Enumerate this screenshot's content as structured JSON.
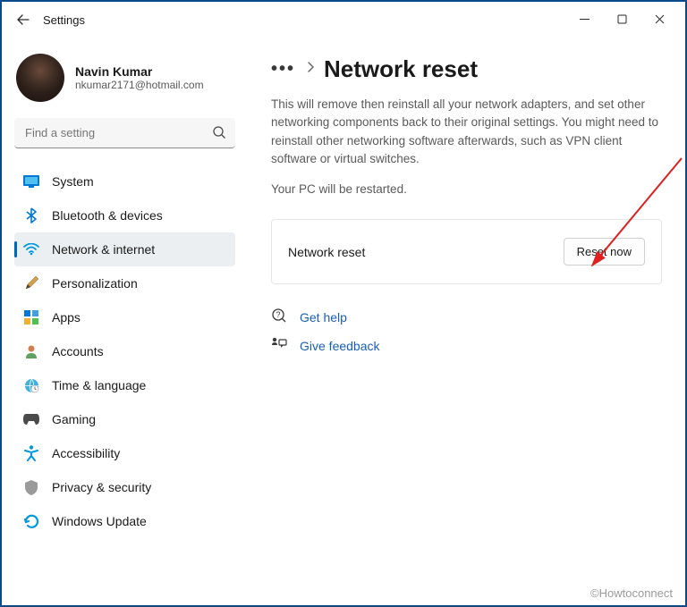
{
  "window": {
    "title": "Settings"
  },
  "user": {
    "name": "Navin Kumar",
    "email": "nkumar2171@hotmail.com"
  },
  "search": {
    "placeholder": "Find a setting"
  },
  "sidebar": {
    "items": [
      {
        "label": "System"
      },
      {
        "label": "Bluetooth & devices"
      },
      {
        "label": "Network & internet"
      },
      {
        "label": "Personalization"
      },
      {
        "label": "Apps"
      },
      {
        "label": "Accounts"
      },
      {
        "label": "Time & language"
      },
      {
        "label": "Gaming"
      },
      {
        "label": "Accessibility"
      },
      {
        "label": "Privacy & security"
      },
      {
        "label": "Windows Update"
      }
    ]
  },
  "page": {
    "title": "Network reset",
    "description": "This will remove then reinstall all your network adapters, and set other networking components back to their original settings. You might need to reinstall other networking software afterwards, such as VPN client software or virtual switches.",
    "restart_note": "Your PC will be restarted.",
    "card": {
      "title": "Network reset",
      "button": "Reset now"
    },
    "links": {
      "help": "Get help",
      "feedback": "Give feedback"
    }
  },
  "watermark": "©Howtoconnect"
}
